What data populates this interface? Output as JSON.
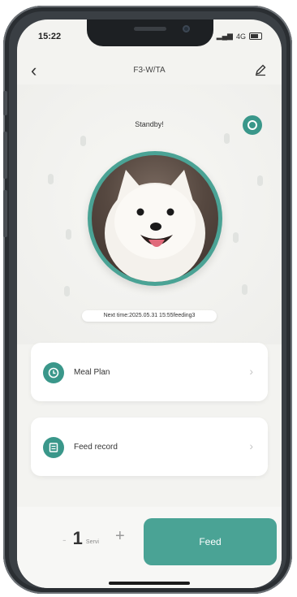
{
  "status_bar": {
    "time": "15:22",
    "network": "4G"
  },
  "header": {
    "title": "F3-W/TA",
    "back_icon": "back-chevron-icon",
    "edit_icon": "pencil-icon"
  },
  "device": {
    "status": "Standby!",
    "next_time": "Next time:2025.05.31 15:55feeding3"
  },
  "menu": [
    {
      "label": "Meal Plan",
      "icon": "clock-icon"
    },
    {
      "label": "Feed record",
      "icon": "list-icon"
    }
  ],
  "feed": {
    "quantity": "1",
    "unit": "Servi",
    "minus": "-",
    "plus": "+",
    "button_label": "Feed"
  },
  "colors": {
    "accent": "#4aa395",
    "accent_dark": "#3a978a",
    "background": "#f3f3f0"
  }
}
